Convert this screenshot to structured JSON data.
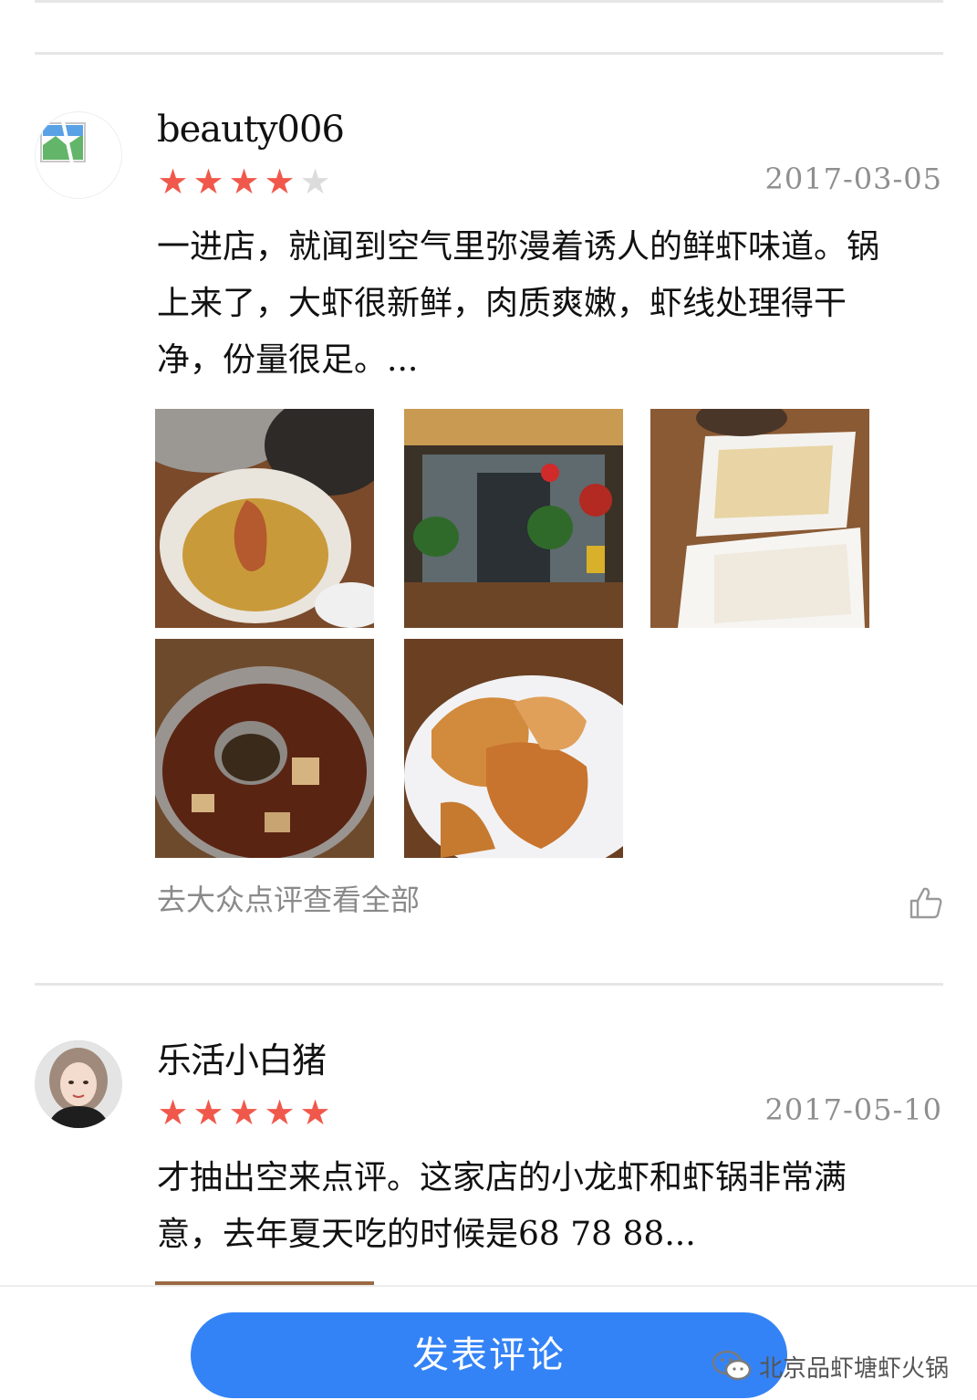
{
  "reviews": [
    {
      "username": "beauty006",
      "rating": 4,
      "max_rating": 5,
      "date": "2017-03-05",
      "content_lines": [
        "一进店，就闻到空气里弥漫着诱人的鲜虾味道。锅",
        "上来了，大虾很新鲜，肉质爽嫩，虾线处理得干",
        "净，份量很足。..."
      ],
      "photos": [
        "shrimp-bowl-photo",
        "restaurant-interior-photo",
        "tofu-skin-plate-photo",
        "hotpot-photo",
        "fried-shrimp-photo"
      ],
      "view_all_link": "去大众点评查看全部"
    },
    {
      "username": "乐活小白猪",
      "rating": 5,
      "max_rating": 5,
      "date": "2017-05-10",
      "content_lines": [
        "才抽出空来点评。这家店的小龙虾和虾锅非常满",
        "意，去年夏天吃的时候是68 78 88..."
      ]
    }
  ],
  "bottom_bar": {
    "post_button": "发表评论",
    "watermark": "北京品虾塘虾火锅"
  },
  "colors": {
    "star_on": "#f0584b",
    "star_off": "#dcdcdc",
    "button": "#3483f6"
  }
}
